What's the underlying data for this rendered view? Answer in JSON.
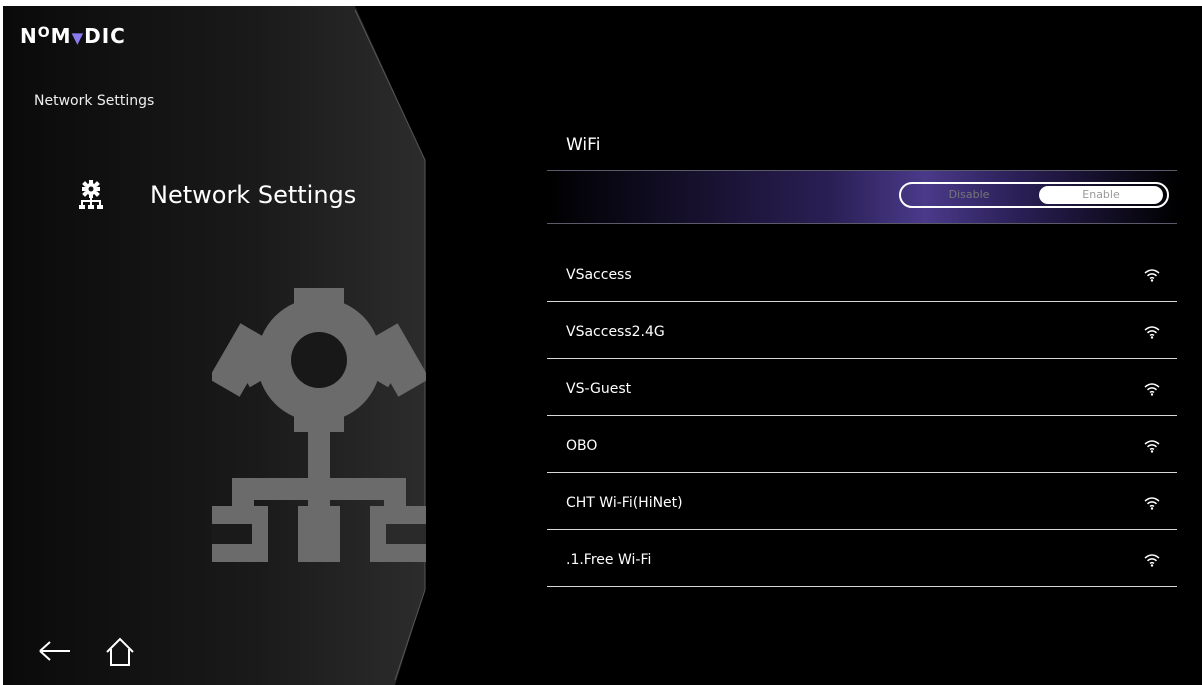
{
  "app": {
    "logo": "NOMVDIC",
    "logo_parts": [
      "N",
      "O",
      "M",
      "▼",
      "DIC"
    ]
  },
  "sidebar": {
    "breadcrumb": "Network Settings",
    "selected_item": {
      "label": "Network Settings",
      "icon": "network-gear-icon"
    },
    "illustration_icon": "network-gear-icon"
  },
  "nav": {
    "back_icon": "back-arrow-icon",
    "home_icon": "home-icon"
  },
  "wifi": {
    "title": "WiFi",
    "toggle": {
      "disable_label": "Disable",
      "enable_label": "Enable",
      "selected": "Enable"
    },
    "networks": [
      {
        "name": "VSaccess",
        "icon": "wifi-signal-icon"
      },
      {
        "name": "VSaccess2.4G",
        "icon": "wifi-signal-icon"
      },
      {
        "name": "VS-Guest",
        "icon": "wifi-signal-icon"
      },
      {
        "name": "OBO",
        "icon": "wifi-signal-icon"
      },
      {
        "name": "CHT Wi-Fi(HiNet)",
        "icon": "wifi-signal-icon"
      },
      {
        "name": ".1.Free Wi-Fi",
        "icon": "wifi-signal-icon"
      }
    ]
  },
  "colors": {
    "accent": "#4a3a8a",
    "background": "#000000",
    "icon_gray": "#6b6b6b"
  }
}
